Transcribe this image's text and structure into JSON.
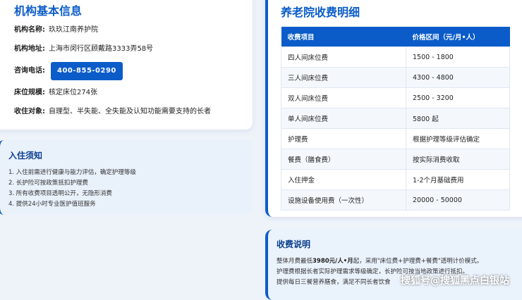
{
  "info": {
    "title": "机构基本信息",
    "name_label": "机构名称:",
    "name_value": "玖玖江南养护院",
    "address_label": "机构地址:",
    "address_value": "上海市闵行区顾戴路3333弄58号",
    "phone_label": "咨询电话:",
    "phone_value": "400-855-0290",
    "beds_label": "床位规模:",
    "beds_value": "核定床位274张",
    "target_label": "收住对象:",
    "target_value": "自理型、半失能、全失能及认知功能需要支持的长者"
  },
  "notice": {
    "title": "入住须知",
    "items": [
      "1. 入住前需进行健康与能力评估，确定护理等级",
      "2. 长护险可按政策抵扣护理费",
      "3. 所有收费项目透明公开，无隐形消费",
      "4. 提供24小时专业医护值班服务"
    ]
  },
  "fees": {
    "title": "养老院收费明细",
    "headers": [
      "收费项目",
      "价格区间（元/月•人）"
    ],
    "rows": [
      [
        "四人间床位费",
        "1500 - 1800"
      ],
      [
        "三人间床位费",
        "4300 - 4800"
      ],
      [
        "双人间床位费",
        "2500 - 3200"
      ],
      [
        "单人间床位费",
        "5800 起"
      ],
      [
        "护理费",
        "根据护理等级评估确定"
      ],
      [
        "餐费（膳食费）",
        "按实际消费收取"
      ],
      [
        "入住押金",
        "1-2个月基础费用"
      ],
      [
        "设施设备使用费（一次性）",
        "20000 - 50000"
      ]
    ]
  },
  "explain": {
    "title": "收费说明",
    "line1_pre": "整体月费最低",
    "line1_bold": "3980元/人•月",
    "line1_post": "起，采用\"床位费+护理费+餐费\"透明计价模式。",
    "line2": "护理费根据长者实际护理需求等级确定，长护险可按当地政策进行抵扣。",
    "line3": "提供每日三餐营养膳食，满足不同长者饮食"
  },
  "watermark": "搜狐号@搜狐黑点白银站"
}
